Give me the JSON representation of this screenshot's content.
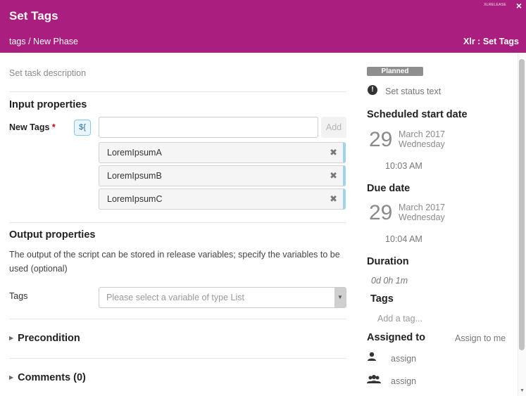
{
  "header": {
    "title": "Set Tags",
    "breadcrumb": "tags / New Phase",
    "task_type": "Xlr : Set Tags",
    "logo_text": "XLRELEASE",
    "close_label": "×",
    "bg_color": "#a91e7f"
  },
  "left": {
    "description_placeholder": "Set task description",
    "input_section_title": "Input properties",
    "new_tags_label": "New Tags",
    "required_mark": "*",
    "variable_button_label": "${",
    "tag_input_value": "",
    "add_button_label": "Add",
    "tags": [
      {
        "label": "LoremIpsumA",
        "remove": "✖"
      },
      {
        "label": "LoremIpsumB",
        "remove": "✖"
      },
      {
        "label": "LoremIpsumC",
        "remove": "✖"
      }
    ],
    "output_section_title": "Output properties",
    "output_description": "The output of the script can be stored in release variables; specify the variables to be used (optional)",
    "tags_label": "Tags",
    "tags_select_placeholder": "Please select a variable of type List",
    "precondition_label": "Precondition",
    "comments_label": "Comments (0)"
  },
  "right": {
    "status_badge": "Planned",
    "status_icon": "exclamation-icon",
    "status_text": "Set status text",
    "scheduled_start": {
      "title": "Scheduled start date",
      "day": "29",
      "month_year": "March 2017",
      "weekday": "Wednesday",
      "time": "10:03 AM"
    },
    "due": {
      "title": "Due date",
      "day": "29",
      "month_year": "March 2017",
      "weekday": "Wednesday",
      "time": "10:04 AM"
    },
    "duration_title": "Duration",
    "duration_value": "0d 0h 1m",
    "tags_title": "Tags",
    "add_tag_placeholder": "Add a tag...",
    "assigned_title": "Assigned to",
    "assign_to_me": "Assign to me",
    "assign_user": "assign",
    "assign_team": "assign"
  }
}
